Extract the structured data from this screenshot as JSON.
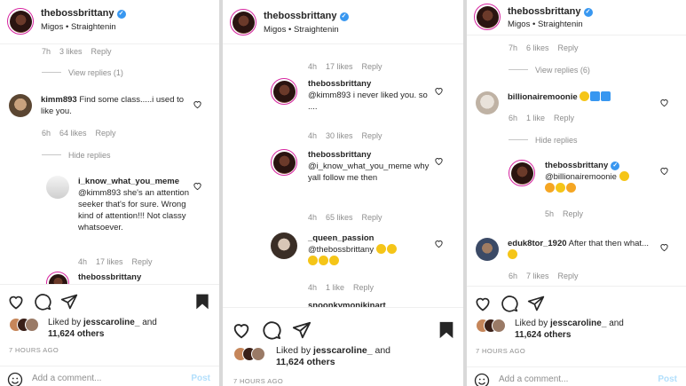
{
  "account": {
    "username": "thebossbrittany",
    "subtitle": "Migos • Straightenin"
  },
  "likes": {
    "liked_by_prefix": "Liked by",
    "liked_by_user": "jesscaroline_",
    "and": "and",
    "others": "11,624 others"
  },
  "time_ago": "7 HOURS AGO",
  "add_comment": {
    "placeholder": "Add a comment...",
    "post": "Post"
  },
  "reply_label": "Reply",
  "colors": {
    "verified": "#3897f0",
    "muted": "#8e8e8e",
    "text": "#262626",
    "post_disabled": "#b2dffc"
  },
  "panel1": {
    "top_meta": {
      "time": "7h",
      "likes": "3 likes"
    },
    "view_replies": "View replies (1)",
    "c1": {
      "user": "kimm893",
      "text": "Find some class.....i used to like you.",
      "time": "6h",
      "likes": "64 likes"
    },
    "hide_replies": "Hide replies",
    "c2": {
      "user": "i_know_what_you_meme",
      "text": "@kimm893 she's an attention seeker that's for sure. Wrong kind of attention!!! Not classy whatsoever.",
      "time": "4h",
      "likes": "17 likes"
    },
    "c3_cut_user": "thebossbrittany"
  },
  "panel2": {
    "top_meta": {
      "time": "4h",
      "likes": "17 likes"
    },
    "c1": {
      "user": "thebossbrittany",
      "text": "@kimm893 i never liked you. so ....",
      "time": "4h",
      "likes": "30 likes"
    },
    "c2": {
      "user": "thebossbrittany",
      "text": "@i_know_what_you_meme why yall follow me then",
      "time": "4h",
      "likes": "65 likes"
    },
    "c3": {
      "user": "_queen_passion",
      "text": "@thebossbrittany",
      "time": "4h",
      "likes": "1 like"
    },
    "c4_cut_user": "snoonkymonikinart"
  },
  "panel3": {
    "top_meta": {
      "time": "7h",
      "likes": "6 likes"
    },
    "view_replies": "View replies (6)",
    "c1": {
      "user": "billionairemoonie",
      "time": "6h",
      "likes": "1 like"
    },
    "hide_replies": "Hide replies",
    "c2": {
      "user": "thebossbrittany",
      "text": "@billionairemoonie",
      "time": "5h"
    },
    "c3": {
      "user": "eduk8tor_1920",
      "text": "After that then what...",
      "time": "6h",
      "likes": "7 likes"
    }
  }
}
